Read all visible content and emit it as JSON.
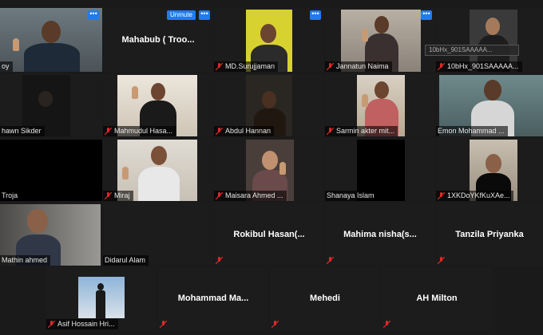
{
  "colors": {
    "accent_blue": "#1f7bf0",
    "active_speaker": "#c8d400",
    "muted_red": "#e02828",
    "tile_bg": "#1c1c1c"
  },
  "controls": {
    "more_label": "•••",
    "unmute_label": "Unmute"
  },
  "tooltip": "10bHx_901SAAAAA...",
  "participants": [
    {
      "name": "oy"
    },
    {
      "name": "Mahabub ( Troo..."
    },
    {
      "name": "MD.Surujjaman"
    },
    {
      "name": "Jannatun Naima"
    },
    {
      "name": "10bHx_901SAAAAA..."
    },
    {
      "name": "hawn Sikder"
    },
    {
      "name": "Mahmudul Hasa..."
    },
    {
      "name": "Abdul Hannan"
    },
    {
      "name": "Sarmin akter mit..."
    },
    {
      "name": "Emon Mohammad ..."
    },
    {
      "name": "Troja"
    },
    {
      "name": "Miraj"
    },
    {
      "name": "Maisara Ahmed ..."
    },
    {
      "name": "Shanaya Islam"
    },
    {
      "name": "1XKDoYKfKuXAe..."
    },
    {
      "name": "Mathin ahmed"
    },
    {
      "name": "Didarul Alam"
    },
    {
      "name": "Rokibul  Hasan(..."
    },
    {
      "name": "Mahima  nisha(s..."
    },
    {
      "name": "Tanzila Priyanka"
    },
    {
      "name": "Asif Hossain Hri..."
    },
    {
      "name": "Mohammad  Ma..."
    },
    {
      "name": "Mehedi"
    },
    {
      "name": "AH Milton"
    }
  ]
}
